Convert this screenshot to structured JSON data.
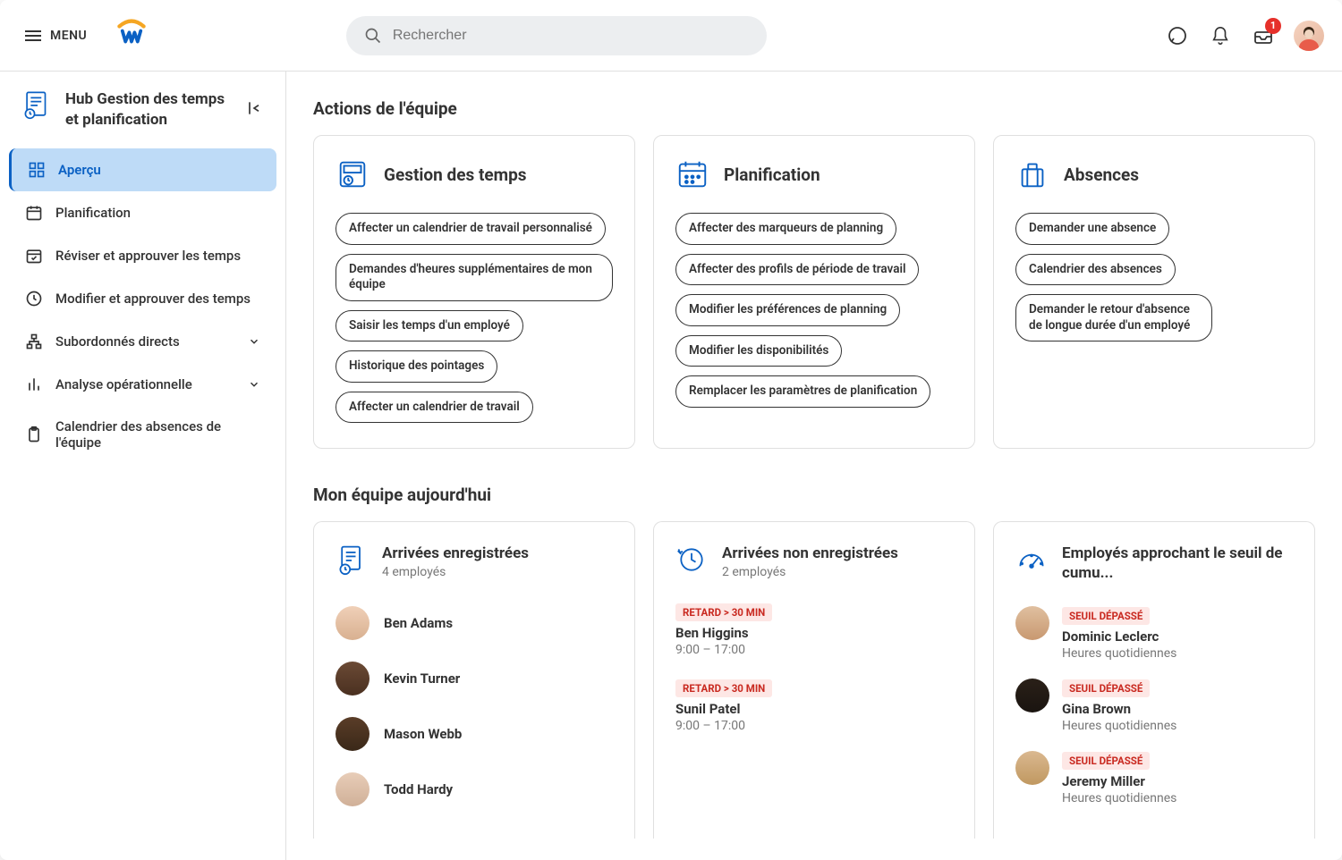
{
  "topbar": {
    "menu_label": "MENU",
    "search_placeholder": "Rechercher",
    "inbox_badge": "1"
  },
  "hub": {
    "title": "Hub Gestion des temps et planification"
  },
  "nav": [
    {
      "label": "Aperçu",
      "icon": "grid",
      "active": true
    },
    {
      "label": "Planification",
      "icon": "calendar"
    },
    {
      "label": "Réviser et approuver les temps",
      "icon": "calendar-check"
    },
    {
      "label": "Modifier et approuver des temps",
      "icon": "clock"
    },
    {
      "label": "Subordonnés directs",
      "icon": "hierarchy",
      "chevron": true
    },
    {
      "label": "Analyse opérationnelle",
      "icon": "bars",
      "chevron": true
    },
    {
      "label": "Calendrier des absences de l'équipe",
      "icon": "clipboard"
    }
  ],
  "section1_title": "Actions de l'équipe",
  "action_cards": [
    {
      "title": "Gestion des temps",
      "icon": "time-mgmt",
      "pills": [
        "Affecter un calendrier de travail personnalisé",
        "Demandes d'heures supplémentaires de mon équipe",
        "Saisir les temps d'un employé",
        "Historique des pointages",
        "Affecter un calendrier de travail"
      ]
    },
    {
      "title": "Planification",
      "icon": "schedule",
      "pills": [
        "Affecter des marqueurs de planning",
        "Affecter des profils de période de travail",
        "Modifier les préférences de planning",
        "Modifier les disponibilités",
        "Remplacer les paramètres de planification"
      ]
    },
    {
      "title": "Absences",
      "icon": "suitcase",
      "pills": [
        "Demander une absence",
        "Calendrier des absences",
        "Demander le retour d'absence de longue durée d'un employé"
      ]
    }
  ],
  "section2_title": "Mon équipe aujourd'hui",
  "team_cards": {
    "clocked_in": {
      "title": "Arrivées enregistrées",
      "sub": "4 employés",
      "people": [
        "Ben Adams",
        "Kevin Turner",
        "Mason Webb",
        "Todd Hardy"
      ]
    },
    "not_clocked": {
      "title": "Arrivées non enregistrées",
      "sub": "2 employés",
      "entries": [
        {
          "tag": "RETARD > 30 MIN",
          "name": "Ben Higgins",
          "time": "9:00 – 17:00"
        },
        {
          "tag": "RETARD > 30 MIN",
          "name": "Sunil Patel",
          "time": "9:00 – 17:00"
        }
      ]
    },
    "threshold": {
      "title": "Employés approchant le seuil de cumu...",
      "entries": [
        {
          "tag": "SEUIL DÉPASSÉ",
          "name": "Dominic Leclerc",
          "sub": "Heures quotidiennes"
        },
        {
          "tag": "SEUIL DÉPASSÉ",
          "name": "Gina Brown",
          "sub": "Heures quotidiennes"
        },
        {
          "tag": "SEUIL DÉPASSÉ",
          "name": "Jeremy Miller",
          "sub": "Heures quotidiennes"
        }
      ]
    }
  }
}
